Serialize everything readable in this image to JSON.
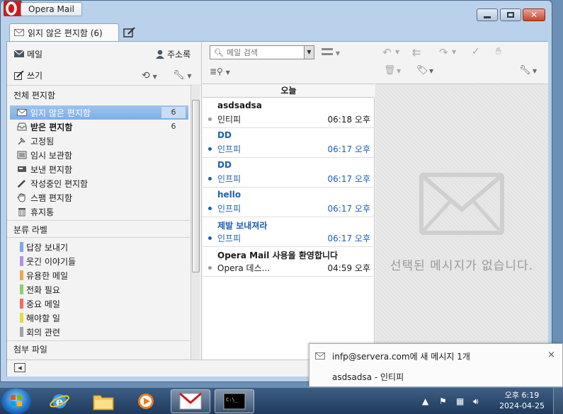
{
  "window": {
    "title": "Opera Mail",
    "active_tab": "읽지 않은 편지함 (6)"
  },
  "toolbar": {
    "mail": "메일",
    "contacts": "주소록",
    "compose": "쓰기"
  },
  "sidebar": {
    "all_mail_header": "전체 편지함",
    "folders": [
      {
        "label": "읽지 않은 편지함",
        "count": "6",
        "selected": true,
        "icon": "envelope-icon"
      },
      {
        "label": "받은 편지함",
        "count": "6",
        "bold": true,
        "icon": "inbox-icon"
      },
      {
        "label": "고정됨",
        "count": "",
        "icon": "pin-icon"
      },
      {
        "label": "임시 보관함",
        "count": "",
        "icon": "drafts-icon"
      },
      {
        "label": "보낸 편지함",
        "count": "",
        "icon": "sent-icon"
      },
      {
        "label": "작성중인 편지함",
        "count": "",
        "icon": "pencil-icon"
      },
      {
        "label": "스팸 편지함",
        "count": "",
        "icon": "hand-icon"
      },
      {
        "label": "휴지통",
        "count": "",
        "icon": "trash-icon"
      }
    ],
    "labels_header": "분류 라벨",
    "labels": [
      {
        "label": "답장 보내기",
        "color": "#7fa8e8"
      },
      {
        "label": "웃긴 이야기들",
        "color": "#b493e0"
      },
      {
        "label": "유용한 메일",
        "color": "#f0a553"
      },
      {
        "label": "전화 필요",
        "color": "#8fd06c"
      },
      {
        "label": "중요 메일",
        "color": "#ef6b63"
      },
      {
        "label": "해야할 일",
        "color": "#e6d94a"
      },
      {
        "label": "회의 관련",
        "color": "#a3a3a3"
      }
    ],
    "attachments_header": "첨부 파일"
  },
  "search": {
    "placeholder": "메일 검색"
  },
  "message_list": {
    "group_header": "오늘",
    "messages": [
      {
        "subject": "asdsadsa",
        "from": "인티피",
        "time": "06:18 오후",
        "unread": false
      },
      {
        "subject": "DD",
        "from": "인프피",
        "time": "06:17 오후",
        "unread": true
      },
      {
        "subject": "DD",
        "from": "인프피",
        "time": "06:17 오후",
        "unread": true
      },
      {
        "subject": "hello",
        "from": "인프피",
        "time": "06:17 오후",
        "unread": true
      },
      {
        "subject": "제발 보내져라",
        "from": "인프피",
        "time": "06:17 오후",
        "unread": true
      },
      {
        "subject": "Opera Mail 사용을 환영합니다",
        "from": "Opera 데스...",
        "time": "04:59 오후",
        "unread": false
      }
    ]
  },
  "preview": {
    "empty_text": "선택된 메시지가 없습니다."
  },
  "notification": {
    "title": "infp@servera.com에 새 메시지 1개",
    "body": "asdsadsa - 인티피",
    "close": "×"
  },
  "taskbar": {
    "time": "오후 6:19",
    "date": "2024-04-25"
  },
  "colors": {
    "accent": "#1b5fb3",
    "selection": "#8ab6ea",
    "opera_red": "#cc1b1b"
  }
}
